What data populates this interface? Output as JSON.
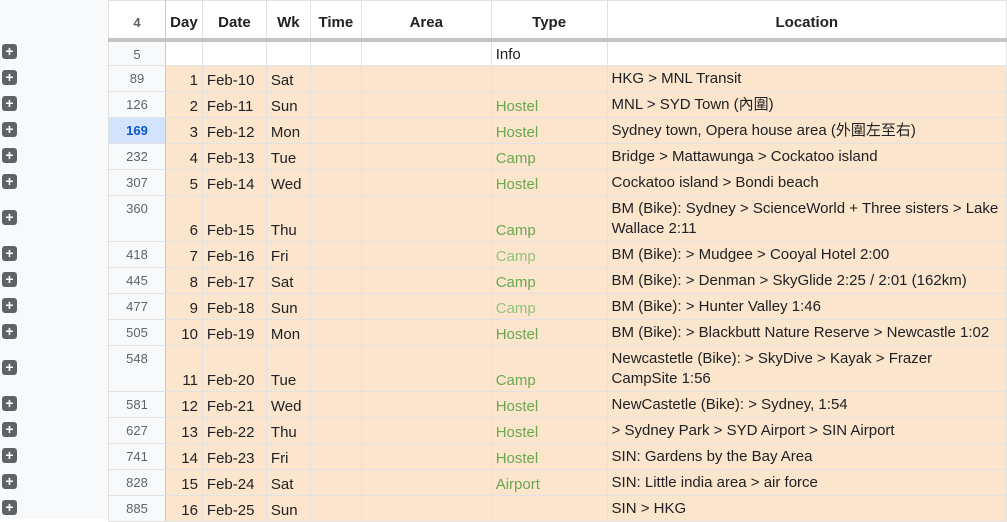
{
  "header": {
    "row_number": "4",
    "day": "Day",
    "date": "Date",
    "wk": "Wk",
    "time": "Time",
    "area": "Area",
    "type": "Type",
    "location": "Location"
  },
  "info_row": {
    "row_number": "5",
    "type": "Info"
  },
  "rows": [
    {
      "rn": "89",
      "day": "1",
      "date": "Feb-10",
      "wk": "Sat",
      "type": "",
      "loc": "HKG > MNL Transit"
    },
    {
      "rn": "126",
      "day": "2",
      "date": "Feb-11",
      "wk": "Sun",
      "type": "Hostel",
      "loc": "MNL > SYD Town (內圍)"
    },
    {
      "rn": "169",
      "day": "3",
      "date": "Feb-12",
      "wk": "Mon",
      "type": "Hostel",
      "loc": "Sydney town, Opera house area (外圍左至右)"
    },
    {
      "rn": "232",
      "day": "4",
      "date": "Feb-13",
      "wk": "Tue",
      "type": "Camp",
      "loc": "Bridge > Mattawunga > Cockatoo island"
    },
    {
      "rn": "307",
      "day": "5",
      "date": "Feb-14",
      "wk": "Wed",
      "type": "Hostel",
      "loc": "Cockatoo island > Bondi beach"
    },
    {
      "rn": "360",
      "day": "6",
      "date": "Feb-15",
      "wk": "Thu",
      "type": "Camp",
      "loc": "BM (Bike): Sydney > ScienceWorld + Three sisters > Lake Wallace  2:11"
    },
    {
      "rn": "418",
      "day": "7",
      "date": "Feb-16",
      "wk": "Fri",
      "type": "Camp",
      "loc": "BM (Bike): > Mudgee > Cooyal Hotel 2:00"
    },
    {
      "rn": "445",
      "day": "8",
      "date": "Feb-17",
      "wk": "Sat",
      "type": "Camp",
      "loc": "BM (Bike): > Denman > SkyGlide 2:25 / 2:01 (162km)"
    },
    {
      "rn": "477",
      "day": "9",
      "date": "Feb-18",
      "wk": "Sun",
      "type": "Camp",
      "loc": "BM (Bike): > Hunter Valley 1:46"
    },
    {
      "rn": "505",
      "day": "10",
      "date": "Feb-19",
      "wk": "Mon",
      "type": "Hostel",
      "loc": "BM (Bike): > Blackbutt Nature Reserve > Newcastle 1:02"
    },
    {
      "rn": "548",
      "day": "11",
      "date": "Feb-20",
      "wk": "Tue",
      "type": "Camp",
      "loc": "Newcastetle (Bike): > SkyDive > Kayak > Frazer CampSite 1:56"
    },
    {
      "rn": "581",
      "day": "12",
      "date": "Feb-21",
      "wk": "Wed",
      "type": "Hostel",
      "loc": "NewCastetle (Bike): > Sydney, 1:54"
    },
    {
      "rn": "627",
      "day": "13",
      "date": "Feb-22",
      "wk": "Thu",
      "type": "Hostel",
      "loc": "> Sydney Park > SYD Airport > SIN Airport"
    },
    {
      "rn": "741",
      "day": "14",
      "date": "Feb-23",
      "wk": "Fri",
      "type": "Hostel",
      "loc": "SIN: Gardens by the Bay Area"
    },
    {
      "rn": "828",
      "day": "15",
      "date": "Feb-24",
      "wk": "Sat",
      "type": "Airport",
      "loc": "SIN: Little india area > air force"
    },
    {
      "rn": "885",
      "day": "16",
      "date": "Feb-25",
      "wk": "Sun",
      "type": "",
      "loc": "SIN > HKG"
    }
  ],
  "selected_row": "169",
  "expand_icon": "plus-box-icon",
  "colors": {
    "row_fill": "#fce5cd",
    "type_green": "#6aa84f",
    "type_light_green": "#93c47d",
    "selected_header": "#d3e3fd"
  }
}
